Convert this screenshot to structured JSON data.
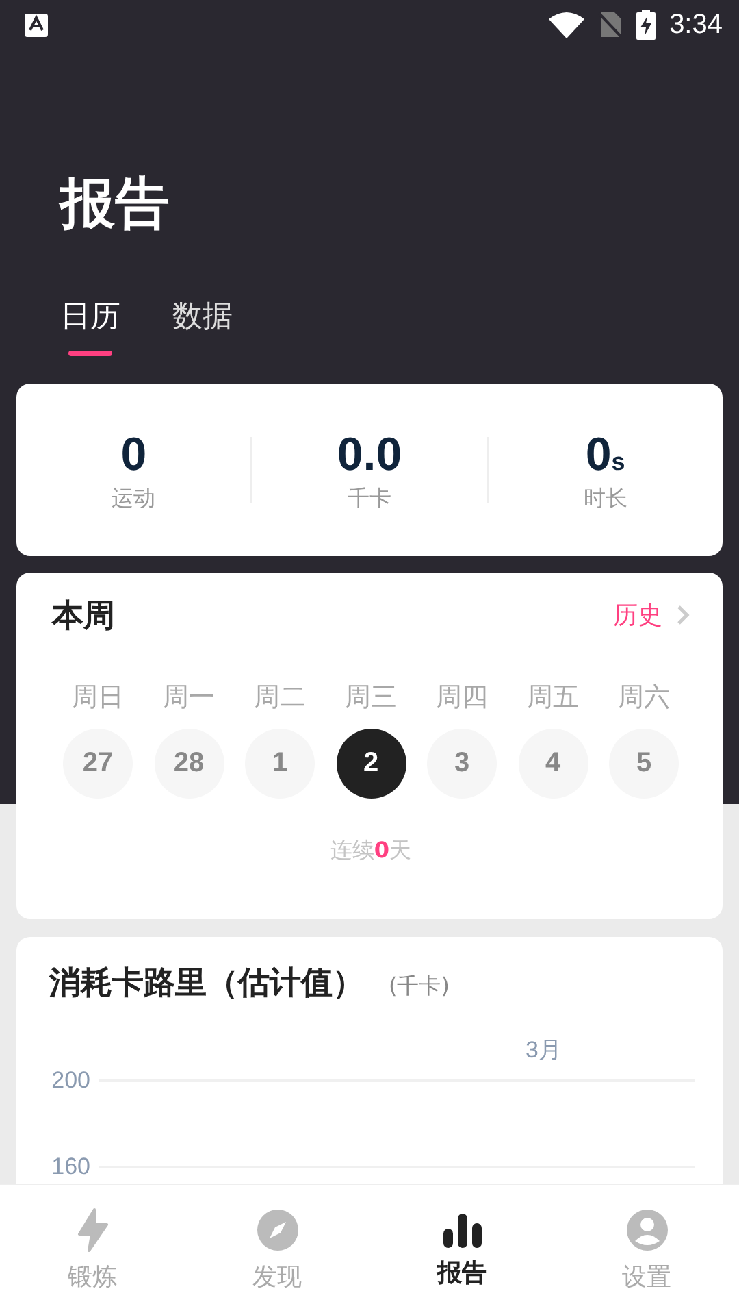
{
  "status_bar": {
    "time": "3:34"
  },
  "header": {
    "title": "报告"
  },
  "tabs": [
    {
      "label": "日历",
      "selected": true
    },
    {
      "label": "数据",
      "selected": false
    }
  ],
  "summary": [
    {
      "value": "0",
      "label": "运动"
    },
    {
      "value": "0.0",
      "label": "千卡"
    },
    {
      "value": "0",
      "unit": "s",
      "label": "时长"
    }
  ],
  "week": {
    "title": "本周",
    "history_link": "历史",
    "streak": "连续**0**天",
    "days": [
      {
        "weekday": "周日",
        "date": "27",
        "selected": false
      },
      {
        "weekday": "周一",
        "date": "28",
        "selected": false
      },
      {
        "weekday": "周二",
        "date": "1",
        "selected": false
      },
      {
        "weekday": "周三",
        "date": "2",
        "selected": true
      },
      {
        "weekday": "周四",
        "date": "3",
        "selected": false
      },
      {
        "weekday": "周五",
        "date": "4",
        "selected": false
      },
      {
        "weekday": "周六",
        "date": "5",
        "selected": false
      }
    ]
  },
  "calories": {
    "title": "消耗卡路里（估计值）",
    "unit": "(千卡)",
    "month_label": "3月",
    "y_labels": [
      "200",
      "160"
    ]
  },
  "bottom_nav": [
    {
      "kind": "bolt",
      "label": "锻炼",
      "selected": false
    },
    {
      "kind": "compass",
      "label": "发现",
      "selected": false
    },
    {
      "kind": "bars",
      "label": "报告",
      "selected": true
    },
    {
      "kind": "person",
      "label": "设置",
      "selected": false
    }
  ]
}
